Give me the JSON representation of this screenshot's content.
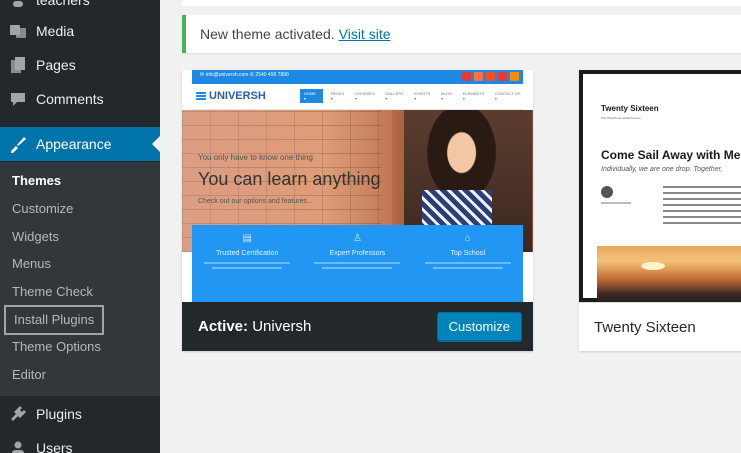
{
  "sidebar": {
    "items": [
      {
        "label": "teachers",
        "icon": "teachers-icon"
      },
      {
        "label": "Media",
        "icon": "media-icon"
      },
      {
        "label": "Pages",
        "icon": "pages-icon"
      },
      {
        "label": "Comments",
        "icon": "comments-icon"
      },
      {
        "label": "Appearance",
        "icon": "appearance-icon"
      },
      {
        "label": "Plugins",
        "icon": "plugins-icon"
      },
      {
        "label": "Users",
        "icon": "users-icon"
      }
    ],
    "submenu": [
      "Themes",
      "Customize",
      "Widgets",
      "Menus",
      "Theme Check",
      "Install Plugins",
      "Theme Options",
      "Editor"
    ]
  },
  "notice": {
    "text": "New theme activated.",
    "link": "Visit site"
  },
  "themes": [
    {
      "name": "Universh",
      "active_prefix": "Active:",
      "customize_label": "Customize",
      "screenshot": {
        "logo": "UNIVERSH",
        "top_info": "✉ info@universh.com   ✆ 2540 456 7890",
        "menu": [
          "HOME ▾",
          "PAGES ▾",
          "COURSES ▾",
          "GALLERY ▾",
          "EVENTS ▾",
          "BLOG ▾",
          "ELEMENTS ▾",
          "CONTACT US ▾"
        ],
        "hero_small": "You only have to know one thing",
        "hero_big": "You can learn anything",
        "hero_sub": "Check out our options and features...",
        "features": [
          {
            "icon": "certificate-icon",
            "title": "Trusted Certification"
          },
          {
            "icon": "professor-icon",
            "title": "Expert Professors"
          },
          {
            "icon": "school-icon",
            "title": "Top School"
          }
        ],
        "colors": {
          "primary": "#2196f3",
          "logo": "#2a5ea8"
        }
      }
    },
    {
      "name": "Twenty Sixteen",
      "screenshot": {
        "site_title": "Twenty Sixteen",
        "tagline": "The WordPress default theme",
        "post_title": "Come Sail Away with Me",
        "intro": "Individually, we are one drop. Together,"
      }
    }
  ],
  "colors": {
    "sidebar": "#23282d",
    "submenu": "#32373c",
    "accent": "#0073aa",
    "notice_border": "#46b450",
    "button": "#0085ba"
  }
}
